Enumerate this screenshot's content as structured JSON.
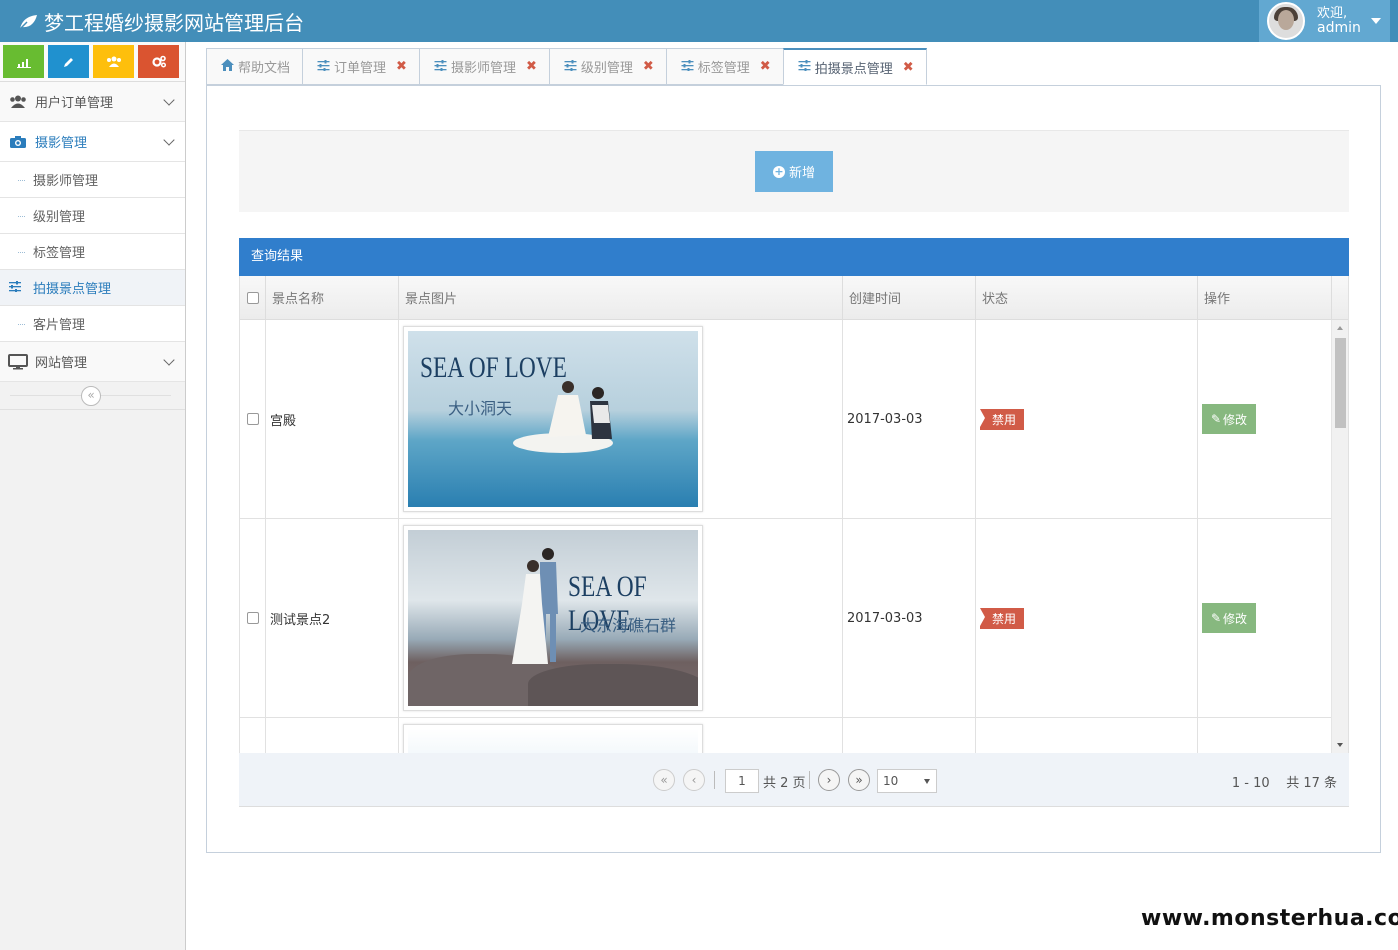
{
  "app": {
    "title": "梦工程婚纱摄影网站管理后台"
  },
  "user": {
    "welcome": "欢迎,",
    "name": "admin"
  },
  "shortcuts": [
    {
      "icon": "signal-icon",
      "color": "#68bc31"
    },
    {
      "icon": "pencil-icon",
      "color": "#2091cf"
    },
    {
      "icon": "users-icon",
      "color": "#febf0c"
    },
    {
      "icon": "cogs-icon",
      "color": "#da5430"
    }
  ],
  "sidebar": {
    "groups": [
      {
        "label": "用户订单管理",
        "icon": "users-icon"
      },
      {
        "label": "摄影管理",
        "icon": "camera-icon"
      },
      {
        "label": "网站管理",
        "icon": "desktop-icon"
      }
    ],
    "sub_items": [
      "摄影师管理",
      "级别管理",
      "标签管理",
      "拍摄景点管理",
      "客片管理"
    ]
  },
  "tabs": [
    {
      "label": "帮助文档",
      "icon": "home-icon",
      "closable": false
    },
    {
      "label": "订单管理",
      "icon": "sliders-icon",
      "closable": true
    },
    {
      "label": "摄影师管理",
      "icon": "sliders-icon",
      "closable": true
    },
    {
      "label": "级别管理",
      "icon": "sliders-icon",
      "closable": true
    },
    {
      "label": "标签管理",
      "icon": "sliders-icon",
      "closable": true
    },
    {
      "label": "拍摄景点管理",
      "icon": "sliders-icon",
      "closable": true,
      "active": true
    }
  ],
  "tab_close_glyph": "✖",
  "toolbar": {
    "add_label": "新增"
  },
  "results": {
    "title": "查询结果",
    "columns": [
      "景点名称",
      "景点图片",
      "创建时间",
      "状态",
      "操作"
    ],
    "rows": [
      {
        "name": "宫殿",
        "image_text": "SEA OF LOVE",
        "image_sub": "大小洞天",
        "date": "2017-03-03",
        "status": "禁用",
        "action": "修改"
      },
      {
        "name": "测试景点2",
        "image_text": "SEA OF LOVE",
        "image_sub": "大东海礁石群",
        "date": "2017-03-03",
        "status": "禁用",
        "action": "修改"
      }
    ]
  },
  "pager": {
    "page": "1",
    "total_pages_text": "共 2 页",
    "page_size": "10",
    "range_text": "1 - 10",
    "total_text": "共 17 条"
  },
  "watermark": "www.monsterhua.com",
  "colors": {
    "header": "#438eb9",
    "accent": "#307ecc",
    "danger": "#d15b47",
    "success": "#87b87f"
  }
}
